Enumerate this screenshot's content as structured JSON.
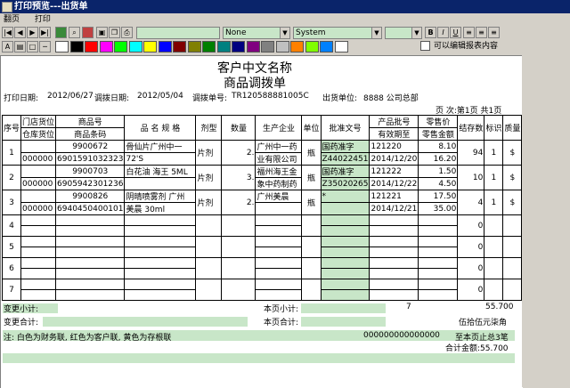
{
  "window": {
    "title": "打印预览---出货单"
  },
  "menu": [
    "翻页",
    "打印"
  ],
  "toolbar": {
    "font_name_select": "None",
    "font_select": "System",
    "bold": "B",
    "italic": "I",
    "underline": "U",
    "editable_checkbox_label": "可以编辑报表内容",
    "swatches": [
      "#ffffff",
      "#000000",
      "#ff0000",
      "#ff00ff",
      "#00ff00",
      "#00ffff",
      "#ffff00",
      "#0000ff",
      "#800000",
      "#808000",
      "#008000",
      "#008080",
      "#000080",
      "#800080",
      "#808080",
      "#c0c0c0",
      "#ff8000",
      "#80ff00",
      "#0080ff",
      "#ffffff"
    ]
  },
  "report": {
    "company": "客户中文名称",
    "doc_title": "商品调拨单",
    "print_date_label": "打印日期:",
    "print_date": "2012/06/27",
    "transfer_date_label": "调拨日期:",
    "transfer_date": "2012/05/04",
    "transfer_no_label": "调拨单号:",
    "transfer_no": "TR120588881005C",
    "out_unit_label": "出货单位:",
    "out_unit": "8888 公司总部",
    "page_label": "页 次:第1页 共1页",
    "headers": {
      "seq": "序号",
      "store": "门店货位",
      "store2": "仓库货位",
      "code": "商品号",
      "barcode": "商品条码",
      "spec": "品 名 规 格",
      "form": "剂型",
      "qty": "数量",
      "maker": "生产企业",
      "unit": "单位",
      "approval": "批准文号",
      "batch": "产品批号",
      "expiry": "有效期至",
      "retail": "零售价",
      "amount": "零售金额",
      "stock": "结存数",
      "mark": "标识",
      "quality": "质量"
    },
    "rows": [
      {
        "seq": "1",
        "store": "",
        "store2": "000000",
        "code": "9900672",
        "barcode": "6901591032323",
        "spec1": "骨仙片广州中一",
        "spec2": "72'S",
        "form": "片剂",
        "qty": "2.",
        "maker1": "广州中一药",
        "maker2": "业有限公司",
        "unit": "瓶",
        "approval1": "国药准字",
        "approval2": "Z44022451",
        "batch": "121220",
        "expiry": "2014/12/20",
        "retail": "8.10",
        "amount": "16.20",
        "stock": "94",
        "mark": "1",
        "quality": "$"
      },
      {
        "seq": "2",
        "store": "",
        "store2": "000000",
        "code": "9900703",
        "barcode": "6905942301236",
        "spec1": "白花油 海王 5ML",
        "spec2": "",
        "form": "片剂",
        "qty": "3.",
        "maker1": "福州海王金",
        "maker2": "象中药制药",
        "unit": "瓶",
        "approval1": "国药准字",
        "approval2": "Z35020265",
        "batch": "121222",
        "expiry": "2014/12/22",
        "retail": "1.50",
        "amount": "4.50",
        "stock": "10",
        "mark": "1",
        "quality": "$"
      },
      {
        "seq": "3",
        "store": "",
        "store2": "000000",
        "code": "9900826",
        "barcode": "6940450400101",
        "spec1": "阴晴喷雾剂  广州",
        "spec2": "美晨 30ml",
        "form": "片剂",
        "qty": "2.",
        "maker1": "广州美晨",
        "maker2": "",
        "unit": "瓶",
        "approval1": "*",
        "approval2": "",
        "batch": "121221",
        "expiry": "2014/12/21",
        "retail": "17.50",
        "amount": "35.00",
        "stock": "4",
        "mark": "1",
        "quality": "$"
      },
      {
        "seq": "4",
        "stock": "0"
      },
      {
        "seq": "5",
        "stock": "0"
      },
      {
        "seq": "6",
        "stock": "0"
      },
      {
        "seq": "7",
        "stock": "0"
      }
    ],
    "change_subtotal_label": "变更小计:",
    "page_subtotal_label": "本页小计:",
    "page_subtotal_qty": "7",
    "page_subtotal_amount": "55.700",
    "change_total_label": "变更合计:",
    "page_total_label": "本页合计:",
    "page_total_text": "伍拾伍元柒角",
    "note": "注: 白色为财务联, 红色为客户联, 黄色为存根联",
    "zeros": "000000000000000",
    "summary1": "至本页止总3笔",
    "summary2": "合计金额:55.700"
  }
}
